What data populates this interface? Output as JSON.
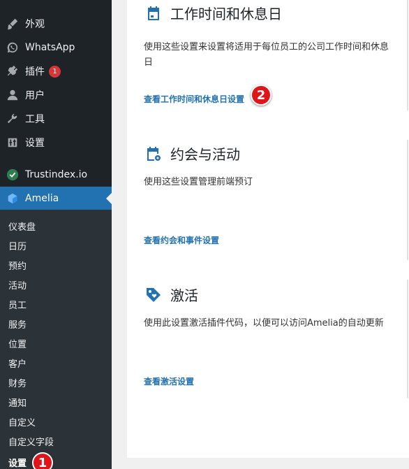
{
  "sidebar": {
    "items": [
      {
        "label": "外观",
        "icon": "paintbrush-icon"
      },
      {
        "label": "WhatsApp",
        "icon": "whatsapp-icon"
      },
      {
        "label": "插件",
        "icon": "plugin-icon",
        "badge": "1"
      },
      {
        "label": "用户",
        "icon": "user-icon"
      },
      {
        "label": "工具",
        "icon": "wrench-icon"
      },
      {
        "label": "设置",
        "icon": "settings-icon"
      },
      {
        "label": "Trustindex.io",
        "icon": "trustindex-icon"
      },
      {
        "label": "Amelia",
        "icon": "amelia-icon"
      }
    ],
    "submenu": [
      "仪表盘",
      "日历",
      "预约",
      "活动",
      "员工",
      "服务",
      "位置",
      "客户",
      "财务",
      "通知",
      "自定义",
      "自定义字段",
      "设置"
    ],
    "step_badge_1": "1"
  },
  "main": {
    "sections": [
      {
        "title": "工作时间和休息日",
        "desc": "使用这些设置来设置将适用于每位员工的公司工作时间和休息日",
        "link": "查看工作时间和休息日设置",
        "icon": "calendar-icon"
      },
      {
        "title": "约会与活动",
        "desc": "使用这些设置管理前端预订",
        "link": "查看约会和事件设置",
        "icon": "calendar-gear-icon"
      },
      {
        "title": "激活",
        "desc": "使用此设置激活插件代码，以便可以访问Amelia的自动更新",
        "link": "查看激活设置",
        "icon": "tag-heart-icon"
      }
    ],
    "step_badge_2": "2"
  },
  "colors": {
    "accent": "#2271b1",
    "sidebar_bg": "#1d2327",
    "badge_red": "#d63638",
    "step_red": "#e0151a"
  }
}
